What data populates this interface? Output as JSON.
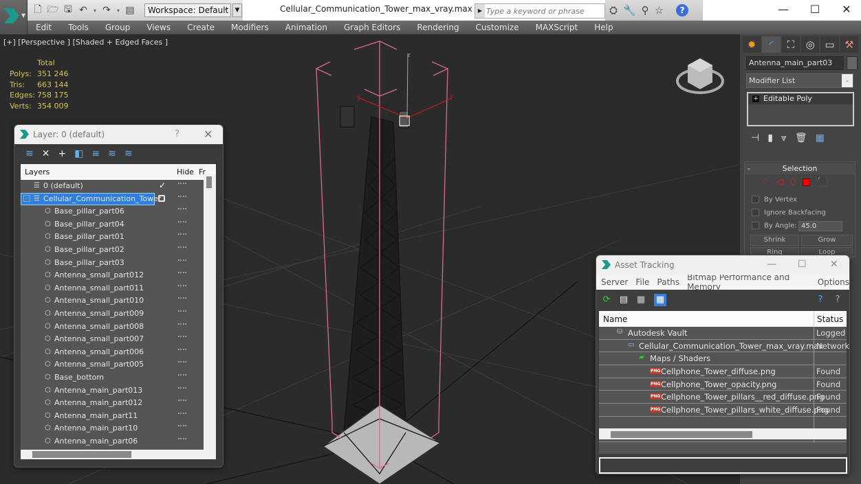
{
  "titlebar": {
    "workspace": "Workspace: Default",
    "document_title": "Cellular_Communication_Tower_max_vray.max",
    "search_placeholder": "Type a keyword or phrase",
    "minimize": "—",
    "maximize": "☐",
    "close": "✕"
  },
  "menu": [
    "Edit",
    "Tools",
    "Group",
    "Views",
    "Create",
    "Modifiers",
    "Animation",
    "Graph Editors",
    "Rendering",
    "Customize",
    "MAXScript",
    "Help"
  ],
  "viewport": {
    "label": "[+] [Perspective ] [Shaded + Edged Faces ]",
    "stats": {
      "header": "Total",
      "rows": [
        {
          "k": "Polys:",
          "v": "351 246"
        },
        {
          "k": "Tris:",
          "v": "663 144"
        },
        {
          "k": "Edges:",
          "v": "758 175"
        },
        {
          "k": "Verts:",
          "v": "354 009"
        }
      ]
    },
    "gizmo_axes": {
      "x": "x",
      "y": "y",
      "z": "z"
    }
  },
  "layer_dialog": {
    "title": "Layer: 0 (default)",
    "help": "?",
    "close": "✕",
    "columns": {
      "layers": "Layers",
      "hide": "Hide",
      "freeze": "Fr"
    },
    "default_layer": "0 (default)",
    "selected_layer": "Cellular_Communication_Tower",
    "objects": [
      "Base_pillar_part06",
      "Base_pillar_part04",
      "Base_pillar_part01",
      "Base_pillar_part02",
      "Base_pillar_part03",
      "Antenna_small_part012",
      "Antenna_small_part011",
      "Antenna_small_part010",
      "Antenna_small_part009",
      "Antenna_small_part008",
      "Antenna_small_part007",
      "Antenna_small_part006",
      "Antenna_small_part005",
      "Base_bottom",
      "Antenna_main_part013",
      "Antenna_main_part012",
      "Antenna_main_part11",
      "Antenna_main_part10",
      "Antenna_main_part06"
    ]
  },
  "command_panel": {
    "object_name": "Antenna_main_part03",
    "modifier_list": "Modifier List",
    "stack_item": "Editable Poly",
    "selection": {
      "title": "Selection",
      "by_vertex": "By Vertex",
      "ignore_backfacing": "Ignore Backfacing",
      "by_angle": "By Angle:",
      "angle_value": "45.0",
      "shrink": "Shrink",
      "grow": "Grow",
      "ring": "Ring",
      "loop": "Loop"
    }
  },
  "asset_tracking": {
    "title": "Asset Tracking",
    "menu": [
      "Server",
      "File",
      "Paths",
      "Bitmap Performance and Memory",
      "Options"
    ],
    "columns": {
      "name": "Name",
      "status": "Status"
    },
    "rows": [
      {
        "name": "Autodesk Vault",
        "status": "Logged",
        "indent": 0,
        "icon": "vault"
      },
      {
        "name": "Cellular_Communication_Tower_max_vray.max",
        "status": "Network",
        "indent": 1,
        "icon": "max"
      },
      {
        "name": "Maps / Shaders",
        "status": "",
        "indent": 2,
        "icon": "maps"
      },
      {
        "name": "Cellphone_Tower_diffuse.png",
        "status": "Found",
        "indent": 3,
        "icon": "png"
      },
      {
        "name": "Cellphone_Tower_opacity.png",
        "status": "Found",
        "indent": 3,
        "icon": "png"
      },
      {
        "name": "Cellphone_Tower_pillars__red_diffuse.png",
        "status": "Found",
        "indent": 3,
        "icon": "png"
      },
      {
        "name": "Cellphone_Tower_pillars_white_diffuse.png",
        "status": "Found",
        "indent": 3,
        "icon": "png"
      }
    ]
  }
}
